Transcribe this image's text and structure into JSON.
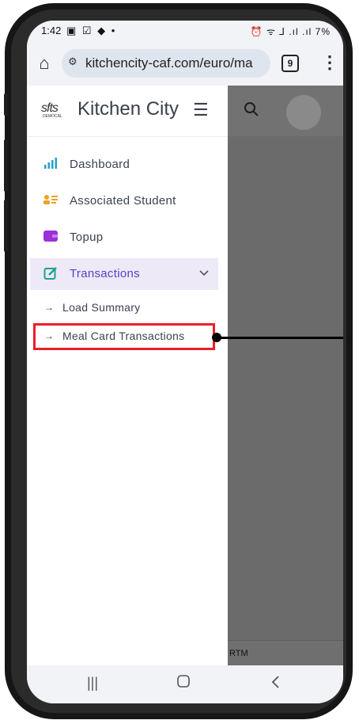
{
  "status_bar": {
    "time": "1:42",
    "left_icons": "▣ ☑ ◆ •",
    "right_icons": "⏰ ᯤ ⅃ .ıl .ıl 7%"
  },
  "browser": {
    "url": "kitchencity-caf.com/euro/ma",
    "tab_count": "9"
  },
  "header": {
    "brand_name": "Kitchen City",
    "logo_text": "sfts",
    "logo_subtext": "DEMOCAL"
  },
  "sidebar": {
    "items": [
      {
        "label": "Dashboard",
        "icon": "bar-chart-icon",
        "color": "#2aa0c8"
      },
      {
        "label": "Associated Student",
        "icon": "contact-card-icon",
        "color": "#f0a020"
      },
      {
        "label": "Topup",
        "icon": "wallet-icon",
        "color": "#9b30d8"
      },
      {
        "label": "Transactions",
        "icon": "edit-icon",
        "color": "#20a090"
      }
    ],
    "sub_items": [
      {
        "label": "Load Summary"
      },
      {
        "label": "Meal Card Transactions"
      }
    ]
  },
  "footer": {
    "text": "RTM"
  },
  "colors": {
    "highlight": "#ea1f2a",
    "active_bg": "#ede9f7",
    "overlay": "#6b6b6b"
  }
}
